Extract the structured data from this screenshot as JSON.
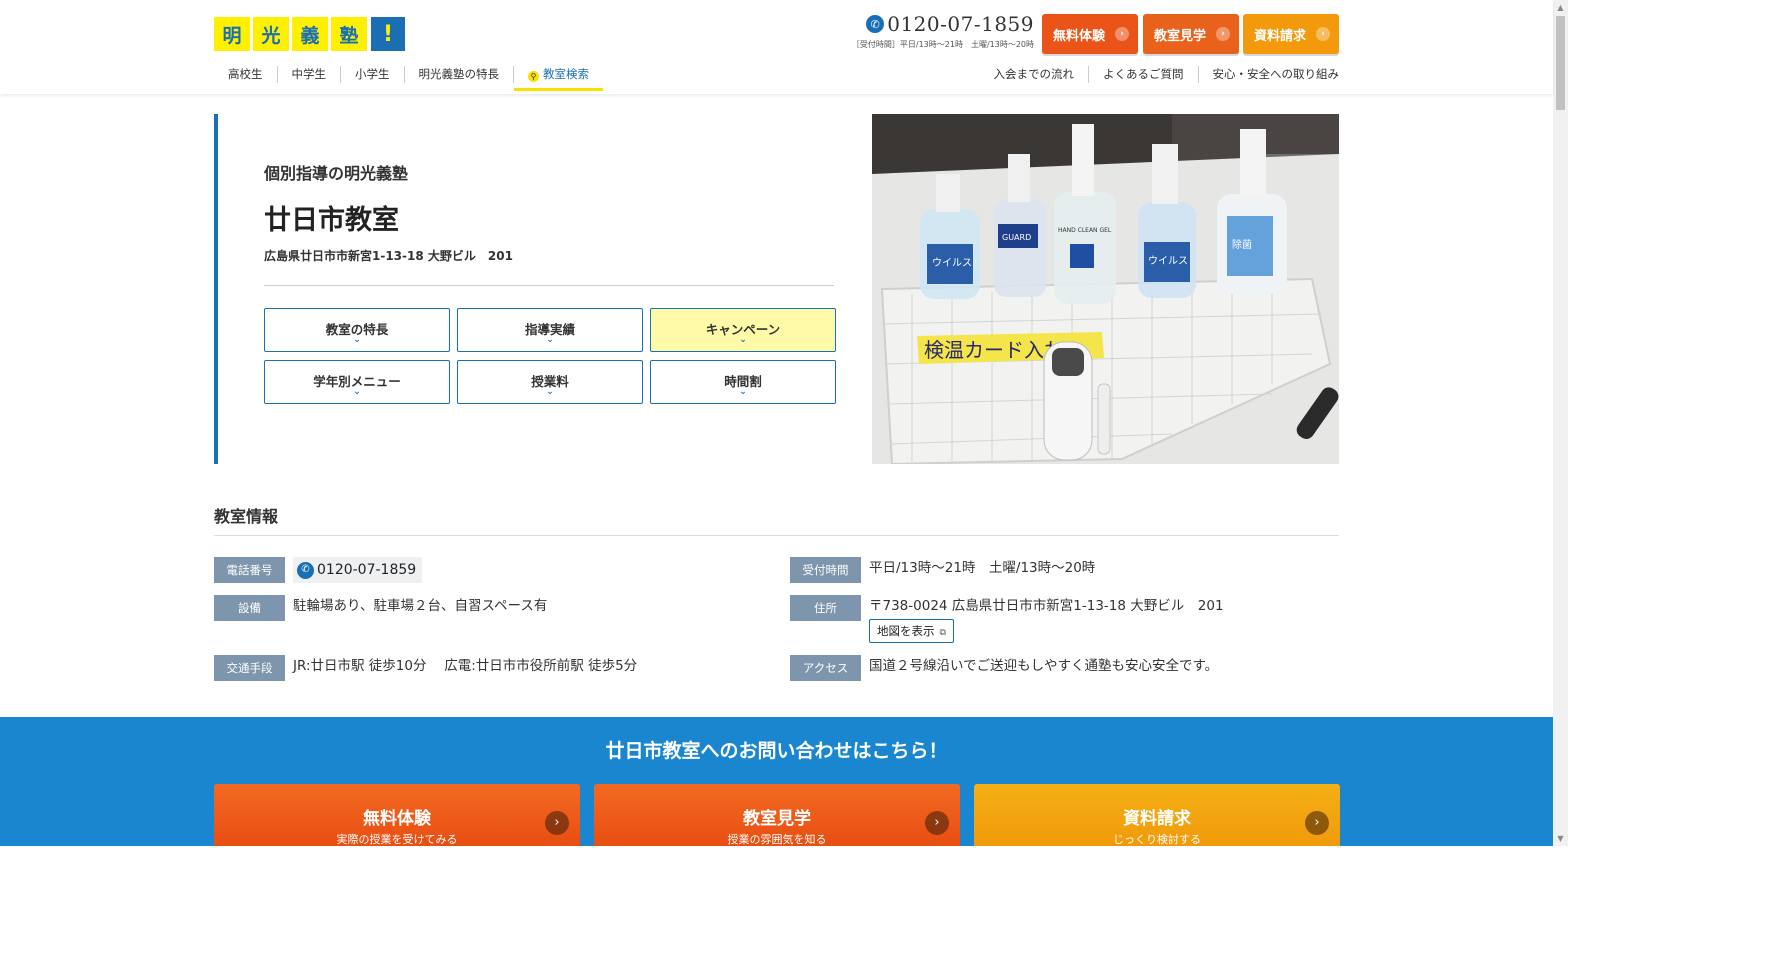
{
  "brand": {
    "logo_chars": [
      "明",
      "光",
      "義",
      "塾"
    ],
    "logo_mark": "!",
    "logo_icon": "meiko-logo",
    "colors": {
      "blue": "#1a6fb4",
      "yellow": "#fff000",
      "orange": "#ea5418",
      "amber": "#f29a0b",
      "contact_bg": "#1a86d0"
    }
  },
  "header": {
    "phone_number": "0120-07-1859",
    "phone_hours": "［受付時間］平日/13時〜21時　土曜/13時〜20時",
    "buttons": [
      {
        "label": "無料体験"
      },
      {
        "label": "教室見学"
      },
      {
        "label": "資料請求"
      }
    ],
    "nav": [
      {
        "label": "高校生"
      },
      {
        "label": "中学生"
      },
      {
        "label": "小学生"
      },
      {
        "label": "明光義塾の特長"
      },
      {
        "label": "教室検索",
        "active": true
      }
    ],
    "subnav": [
      {
        "label": "入会までの流れ"
      },
      {
        "label": "よくあるご質問"
      },
      {
        "label": "安心・安全への取り組み"
      }
    ]
  },
  "hero": {
    "subtitle": "個別指導の明光義塾",
    "title": "廿日市教室",
    "address": "広島県廿日市市新宮1-13-18 大野ビル　201",
    "tabs": [
      {
        "label": "教室の特長"
      },
      {
        "label": "指導実績"
      },
      {
        "label": "キャンペーン",
        "highlighted": true
      },
      {
        "label": "学年別メニュー"
      },
      {
        "label": "授業料"
      },
      {
        "label": "時間割"
      }
    ],
    "photo": {
      "label_text": "検温カード入れ",
      "bottle_labels": [
        "ウイルス",
        "GUARD",
        "HAND CLEAN GEL",
        "ウイルス",
        "除菌"
      ]
    }
  },
  "info": {
    "heading": "教室情報",
    "tel_label": "電話番号",
    "tel_value": "0120-07-1859",
    "hours_label": "受付時間",
    "hours_value": "平日/13時〜21時　土曜/13時〜20時",
    "facility_label": "設備",
    "facility_value": "駐輪場あり、駐車場２台、自習スペース有",
    "address_label": "住所",
    "address_value": "〒738-0024 広島県廿日市市新宮1-13-18 大野ビル　201",
    "map_button": "地図を表示",
    "transport_label": "交通手段",
    "transport_value": "JR:廿日市駅 徒歩10分　 広電:廿日市市役所前駅 徒歩5分",
    "access_label": "アクセス",
    "access_value": "国道２号線沿いでご送迎もしやすく通塾も安心安全です。"
  },
  "contact": {
    "title": "廿日市教室へのお問い合わせはこちら！",
    "buttons": [
      {
        "label": "無料体験",
        "sub": "実際の授業を受けてみる"
      },
      {
        "label": "教室見学",
        "sub": "授業の雰囲気を知る"
      },
      {
        "label": "資料請求",
        "sub": "じっくり検討する"
      }
    ]
  }
}
